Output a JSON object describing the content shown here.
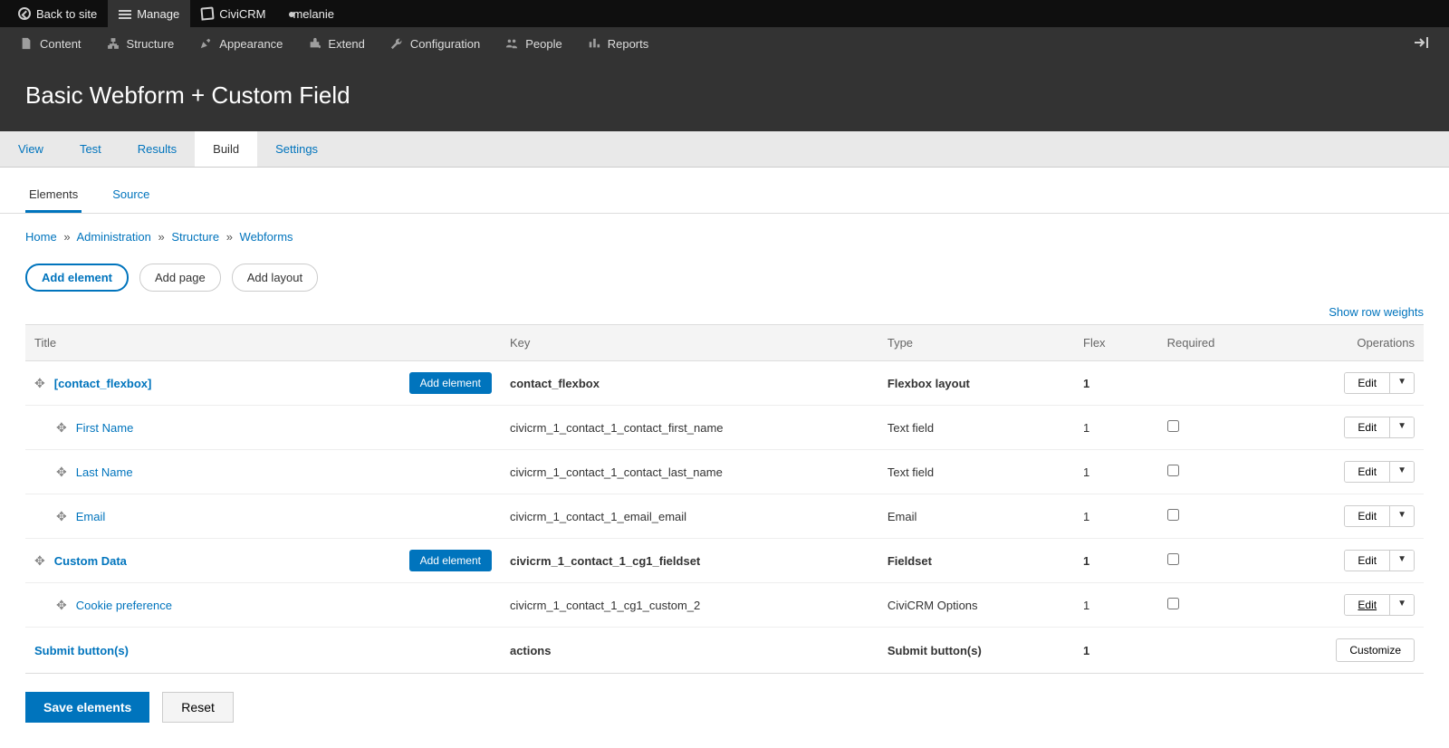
{
  "toolbar": {
    "back": "Back to site",
    "manage": "Manage",
    "civi": "CiviCRM",
    "user": "melanie"
  },
  "admin_menu": {
    "items": [
      {
        "label": "Content"
      },
      {
        "label": "Structure"
      },
      {
        "label": "Appearance"
      },
      {
        "label": "Extend"
      },
      {
        "label": "Configuration"
      },
      {
        "label": "People"
      },
      {
        "label": "Reports"
      }
    ]
  },
  "page": {
    "title": "Basic Webform + Custom Field"
  },
  "primary_tabs": {
    "items": [
      {
        "label": "View"
      },
      {
        "label": "Test"
      },
      {
        "label": "Results"
      },
      {
        "label": "Build"
      },
      {
        "label": "Settings"
      }
    ]
  },
  "secondary_tabs": {
    "items": [
      {
        "label": "Elements"
      },
      {
        "label": "Source"
      }
    ]
  },
  "breadcrumb": {
    "home": "Home",
    "admin": "Administration",
    "structure": "Structure",
    "webforms": "Webforms",
    "sep": "»"
  },
  "actions": {
    "add_element": "Add element",
    "add_page": "Add page",
    "add_layout": "Add layout",
    "show_weights": "Show row weights"
  },
  "table": {
    "headers": {
      "title": "Title",
      "key": "Key",
      "type": "Type",
      "flex": "Flex",
      "required": "Required",
      "operations": "Operations"
    },
    "rows": [
      {
        "title": "[contact_flexbox]",
        "key": "contact_flexbox",
        "type": "Flexbox layout",
        "flex": "1",
        "checkbox": false,
        "bold": true,
        "indent": 0,
        "add": true,
        "op": "edit"
      },
      {
        "title": "First Name",
        "key": "civicrm_1_contact_1_contact_first_name",
        "type": "Text field",
        "flex": "1",
        "checkbox": true,
        "bold": false,
        "indent": 1,
        "add": false,
        "op": "edit"
      },
      {
        "title": "Last Name",
        "key": "civicrm_1_contact_1_contact_last_name",
        "type": "Text field",
        "flex": "1",
        "checkbox": true,
        "bold": false,
        "indent": 1,
        "add": false,
        "op": "edit"
      },
      {
        "title": "Email",
        "key": "civicrm_1_contact_1_email_email",
        "type": "Email",
        "flex": "1",
        "checkbox": true,
        "bold": false,
        "indent": 1,
        "add": false,
        "op": "edit"
      },
      {
        "title": "Custom Data",
        "key": "civicrm_1_contact_1_cg1_fieldset",
        "type": "Fieldset",
        "flex": "1",
        "checkbox": true,
        "bold": true,
        "indent": 0,
        "add": true,
        "op": "edit"
      },
      {
        "title": "Cookie preference",
        "key": "civicrm_1_contact_1_cg1_custom_2",
        "type": "CiviCRM Options",
        "flex": "1",
        "checkbox": true,
        "bold": false,
        "indent": 1,
        "add": false,
        "op": "edit-ul"
      },
      {
        "title": "Submit button(s)",
        "key": "actions",
        "type": "Submit button(s)",
        "flex": "1",
        "checkbox": false,
        "bold": true,
        "indent": 0,
        "add": false,
        "op": "customize",
        "nodrag": true
      }
    ],
    "add_label": "Add element",
    "edit_label": "Edit",
    "customize_label": "Customize"
  },
  "footer": {
    "save": "Save elements",
    "reset": "Reset"
  }
}
